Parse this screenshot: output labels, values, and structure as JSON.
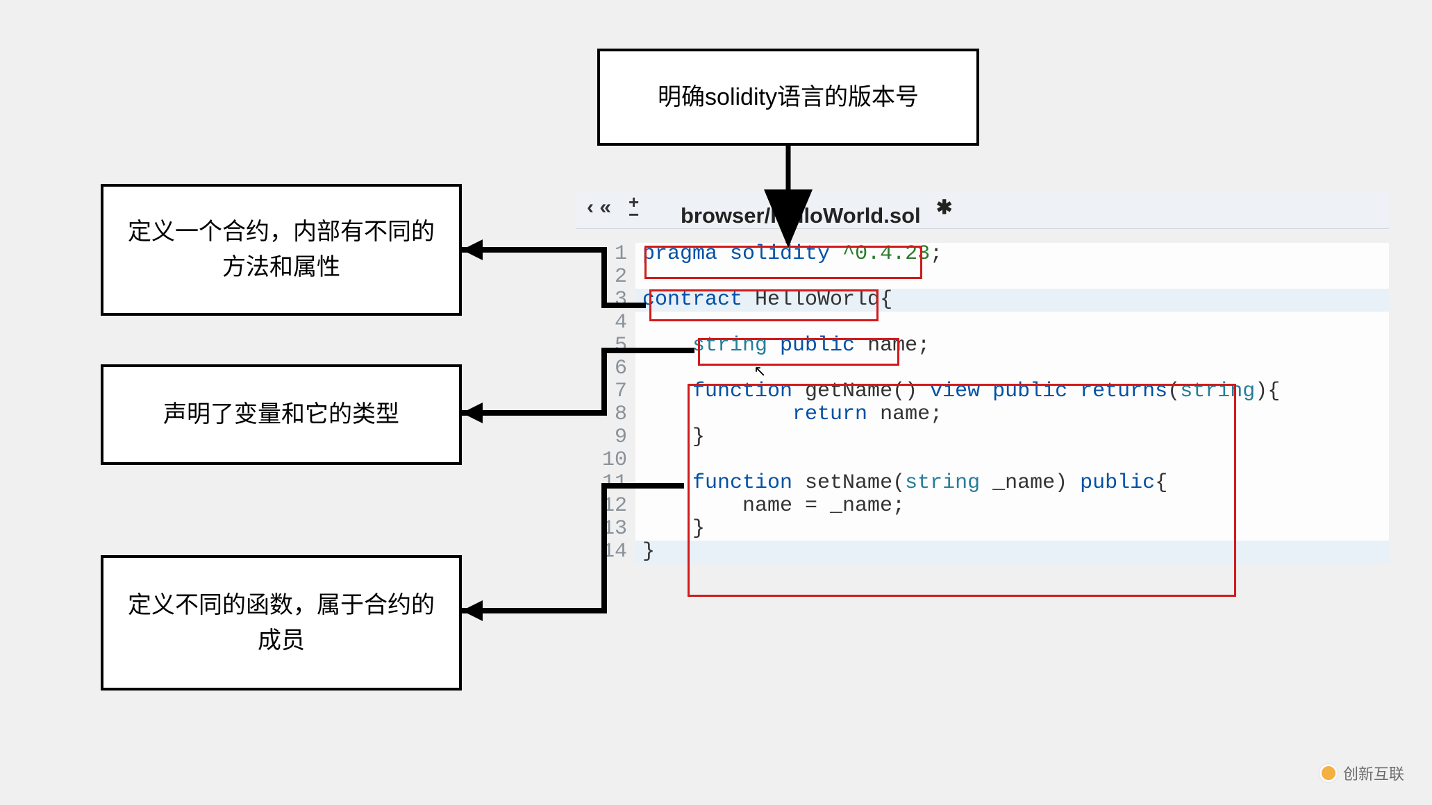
{
  "annotations": {
    "top": "明确solidity语言的版本号",
    "left1": "定义一个合约，内部有不同的方法和属性",
    "left2": "声明了变量和它的类型",
    "left3": "定义不同的函数，属于合约的成员"
  },
  "editor": {
    "tab_prev": "‹",
    "tab_prev2": "«",
    "tab_plus": "+",
    "tab_minus": "−",
    "tab_name": "browser/HelloWorld.sol",
    "tab_close": "✱",
    "lines": {
      "1": {
        "num": "1",
        "tokens": [
          {
            "t": "pragma ",
            "c": "c-kw"
          },
          {
            "t": "solidity ",
            "c": "c-kw"
          },
          {
            "t": "^0.4.23",
            "c": "c-green"
          },
          {
            "t": ";",
            "c": "c-plain"
          }
        ]
      },
      "2": {
        "num": "2",
        "tokens": [
          {
            "t": " ",
            "c": "c-plain"
          }
        ]
      },
      "3": {
        "num": "3 ▾",
        "tokens": [
          {
            "t": "contract ",
            "c": "c-kw"
          },
          {
            "t": "HelloWorld",
            "c": "c-plain"
          },
          {
            "t": "{",
            "c": "c-plain"
          }
        ]
      },
      "4": {
        "num": "4",
        "tokens": [
          {
            "t": " ",
            "c": "c-plain"
          }
        ]
      },
      "5": {
        "num": "5",
        "tokens": [
          {
            "t": "    ",
            "c": "c-plain"
          },
          {
            "t": "string ",
            "c": "c-type"
          },
          {
            "t": "public ",
            "c": "c-kw"
          },
          {
            "t": "name",
            "c": "c-plain"
          },
          {
            "t": ";",
            "c": "c-plain"
          }
        ]
      },
      "6": {
        "num": "6",
        "tokens": [
          {
            "t": " ",
            "c": "c-plain"
          }
        ]
      },
      "7": {
        "num": "7 ▾",
        "tokens": [
          {
            "t": "    ",
            "c": "c-plain"
          },
          {
            "t": "function ",
            "c": "c-kw"
          },
          {
            "t": "getName",
            "c": "c-plain"
          },
          {
            "t": "() ",
            "c": "c-plain"
          },
          {
            "t": "view ",
            "c": "c-kw"
          },
          {
            "t": "public ",
            "c": "c-kw"
          },
          {
            "t": "returns",
            "c": "c-kw"
          },
          {
            "t": "(",
            "c": "c-plain"
          },
          {
            "t": "string",
            "c": "c-type"
          },
          {
            "t": "){",
            "c": "c-plain"
          }
        ]
      },
      "8": {
        "num": "8",
        "tokens": [
          {
            "t": "            ",
            "c": "c-plain"
          },
          {
            "t": "return ",
            "c": "c-kw"
          },
          {
            "t": "name;",
            "c": "c-plain"
          }
        ]
      },
      "9": {
        "num": "9",
        "tokens": [
          {
            "t": "    }",
            "c": "c-plain"
          }
        ]
      },
      "10": {
        "num": "10",
        "tokens": [
          {
            "t": " ",
            "c": "c-plain"
          }
        ]
      },
      "11": {
        "num": "11 ▾",
        "tokens": [
          {
            "t": "    ",
            "c": "c-plain"
          },
          {
            "t": "function ",
            "c": "c-kw"
          },
          {
            "t": "setName",
            "c": "c-plain"
          },
          {
            "t": "(",
            "c": "c-plain"
          },
          {
            "t": "string ",
            "c": "c-type"
          },
          {
            "t": "_name",
            "c": "c-plain"
          },
          {
            "t": ") ",
            "c": "c-plain"
          },
          {
            "t": "public",
            "c": "c-kw"
          },
          {
            "t": "{",
            "c": "c-plain"
          }
        ]
      },
      "12": {
        "num": "12",
        "tokens": [
          {
            "t": "        name = _name;",
            "c": "c-plain"
          }
        ]
      },
      "13": {
        "num": "13",
        "tokens": [
          {
            "t": "    }",
            "c": "c-plain"
          }
        ]
      },
      "14": {
        "num": "14",
        "tokens": [
          {
            "t": "}",
            "c": "c-plain"
          }
        ]
      }
    }
  },
  "watermark": "创新互联"
}
